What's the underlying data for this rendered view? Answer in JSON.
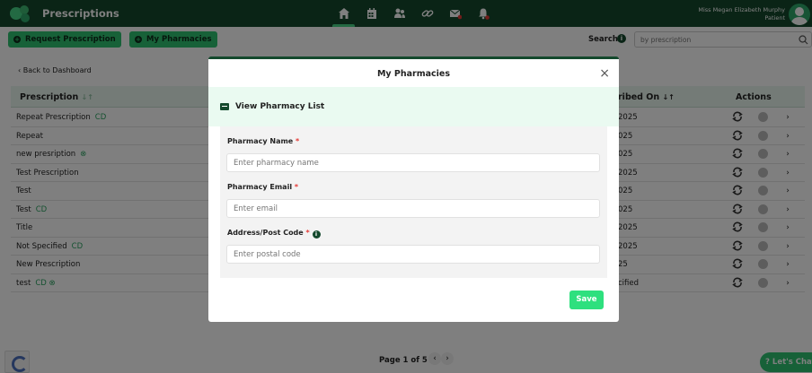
{
  "app": {
    "title": "Prescriptions"
  },
  "user": {
    "name": "Miss Megan Elizabeth Murphy",
    "role": "Patient"
  },
  "nav": {
    "icons": [
      "home-icon",
      "calendar-icon",
      "users-icon",
      "link-icon",
      "mail-icon",
      "bell-icon"
    ],
    "active": "home-icon"
  },
  "toolbar": {
    "request_label": "Request Prescription",
    "pharmacies_label": "My Pharmacies",
    "search_label": "Search:",
    "search_placeholder": "by prescription"
  },
  "page": {
    "back_label": "Back to Dashboard",
    "col_prescription": "Prescription",
    "col_prescribed": "ribed On",
    "col_actions": "Actions",
    "pagination": "Page 1 of 5",
    "chat_label": "Let's Chat"
  },
  "rows": [
    {
      "name": "Repeat Prescription",
      "tag": "CD",
      "date": "2025"
    },
    {
      "name": "Repeat",
      "tag": "",
      "date": "025"
    },
    {
      "name": "new presription",
      "tag": "⊗",
      "date": "025"
    },
    {
      "name": "Test Prescription",
      "tag": "",
      "date": "2025"
    },
    {
      "name": "Test",
      "tag": "",
      "date": "025"
    },
    {
      "name": "Test",
      "tag": "CD",
      "date": "025"
    },
    {
      "name": "Title",
      "tag": "",
      "date": "2025"
    },
    {
      "name": "Not Specified",
      "tag": "CD",
      "date": "2025"
    },
    {
      "name": "New Prescription",
      "tag": "",
      "date": "25"
    },
    {
      "name": "test",
      "tag": "CD ⊗",
      "date": "cified"
    }
  ],
  "modal": {
    "title": "My Pharmacies",
    "close": "×",
    "view_list_label": "View Pharmacy List",
    "name_label": "Pharmacy Name",
    "name_placeholder": "Enter pharmacy name",
    "email_label": "Pharmacy Email",
    "email_placeholder": "Enter email",
    "address_label": "Address/Post Code",
    "address_placeholder": "Enter postal code",
    "required_mark": "*",
    "save_label": "Save"
  },
  "colors": {
    "nav_bg": "#14492d",
    "accent": "#2ec270",
    "save": "#2ee07e"
  }
}
